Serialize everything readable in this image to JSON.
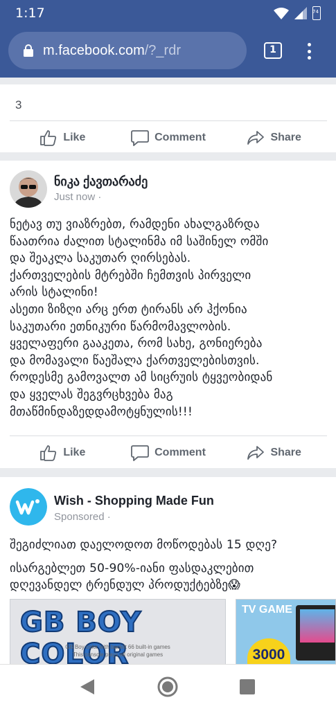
{
  "status_bar": {
    "time": "1:17",
    "battery_level": "74"
  },
  "browser": {
    "url_host": "m.facebook.com",
    "url_path": "/?_rdr",
    "tab_count": "1"
  },
  "card1": {
    "count": "3"
  },
  "actions": {
    "like": "Like",
    "comment": "Comment",
    "share": "Share"
  },
  "post": {
    "author": "ნიკა ქავთარაძე",
    "time": "Just now",
    "separator": "·",
    "text": "ნეტავ თუ ვიაზრებთ, რამდენი ახალგაზრდა\nწაათრია ძალით სტალინმა იმ საშინელ ომში\nდა შეაკლა საკუთარ ღირსებას.\nქართველების მტრებში ჩემთვის პირველი\nარის სტალინი!\nასეთი ზიზღი არც ერთ ტირანს არ ჰქონია\nსაკუთარი ეთნიკური წარმომავლობის.\nყველაფერი გააკეთა, რომ სახე, გონიერება\nდა მომავალი წაეშალა ქართველებისთვის.\nროდესმე გამოვალთ ამ სიცრუის ტყვეობიდან\nდა ყველას შეგვრცხვება მაგ\nმთაწმინდაზედდამოტყნულის!!!"
  },
  "ad": {
    "advertiser": "Wish - Shopping Made Fun",
    "label": "Sponsored",
    "separator": "·",
    "line1": "შეგიძლიათ დაელოდოთ მოწოდებას 15 დღე?",
    "line2": "ისარგებლეთ 50-90%-იანი ფასდაკლებით",
    "line3": "დღევანდელ ტრენდულ პროდუქტებზე😱",
    "carousel": [
      {
        "title": "GB BOY COLOR",
        "caption1": "GB Boy color with backlit 66 built-in games",
        "caption2": "This console plays all original games"
      },
      {
        "title": "TV GAME",
        "price": "3000"
      }
    ]
  },
  "colors": {
    "facebook_blue": "#3b5998",
    "wish_blue": "#2fb7ec"
  }
}
